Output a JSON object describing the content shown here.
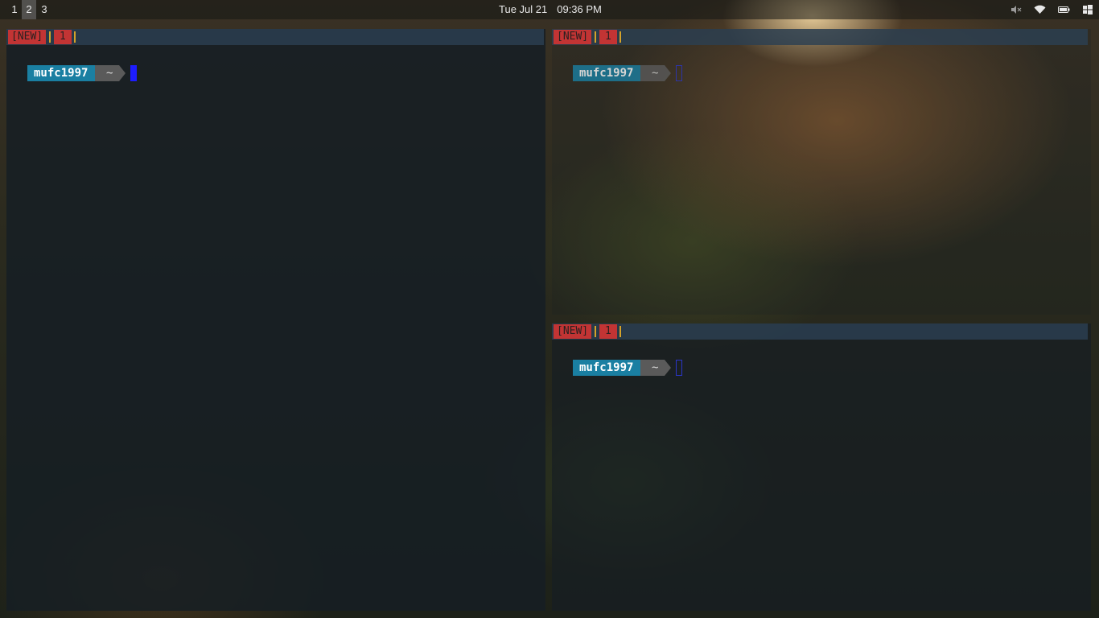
{
  "topbar": {
    "workspaces": [
      "1",
      "2",
      "3"
    ],
    "active_workspace": "2",
    "date": "Tue Jul 21",
    "time": "09:36 PM",
    "tray_icons": [
      "volume-muted-icon",
      "wifi-icon",
      "battery-icon",
      "windows-icon"
    ]
  },
  "panes": [
    {
      "id": "left",
      "status": {
        "new_tag": "[NEW]",
        "window_index": "1"
      },
      "prompt": {
        "user": "mufc1997",
        "dir": "~"
      }
    },
    {
      "id": "top-right",
      "status": {
        "new_tag": "[NEW]",
        "window_index": "1"
      },
      "prompt": {
        "user": "mufc1997",
        "dir": "~"
      }
    },
    {
      "id": "bottom-right",
      "status": {
        "new_tag": "[NEW]",
        "window_index": "1"
      },
      "prompt": {
        "user": "mufc1997",
        "dir": "~"
      }
    }
  ],
  "colors": {
    "status_red": "#c23434",
    "status_yellow": "#d4a22a",
    "user_segment": "#1a7fa2",
    "dir_segment": "#5a5a5a",
    "cursor": "#1d1dff"
  }
}
